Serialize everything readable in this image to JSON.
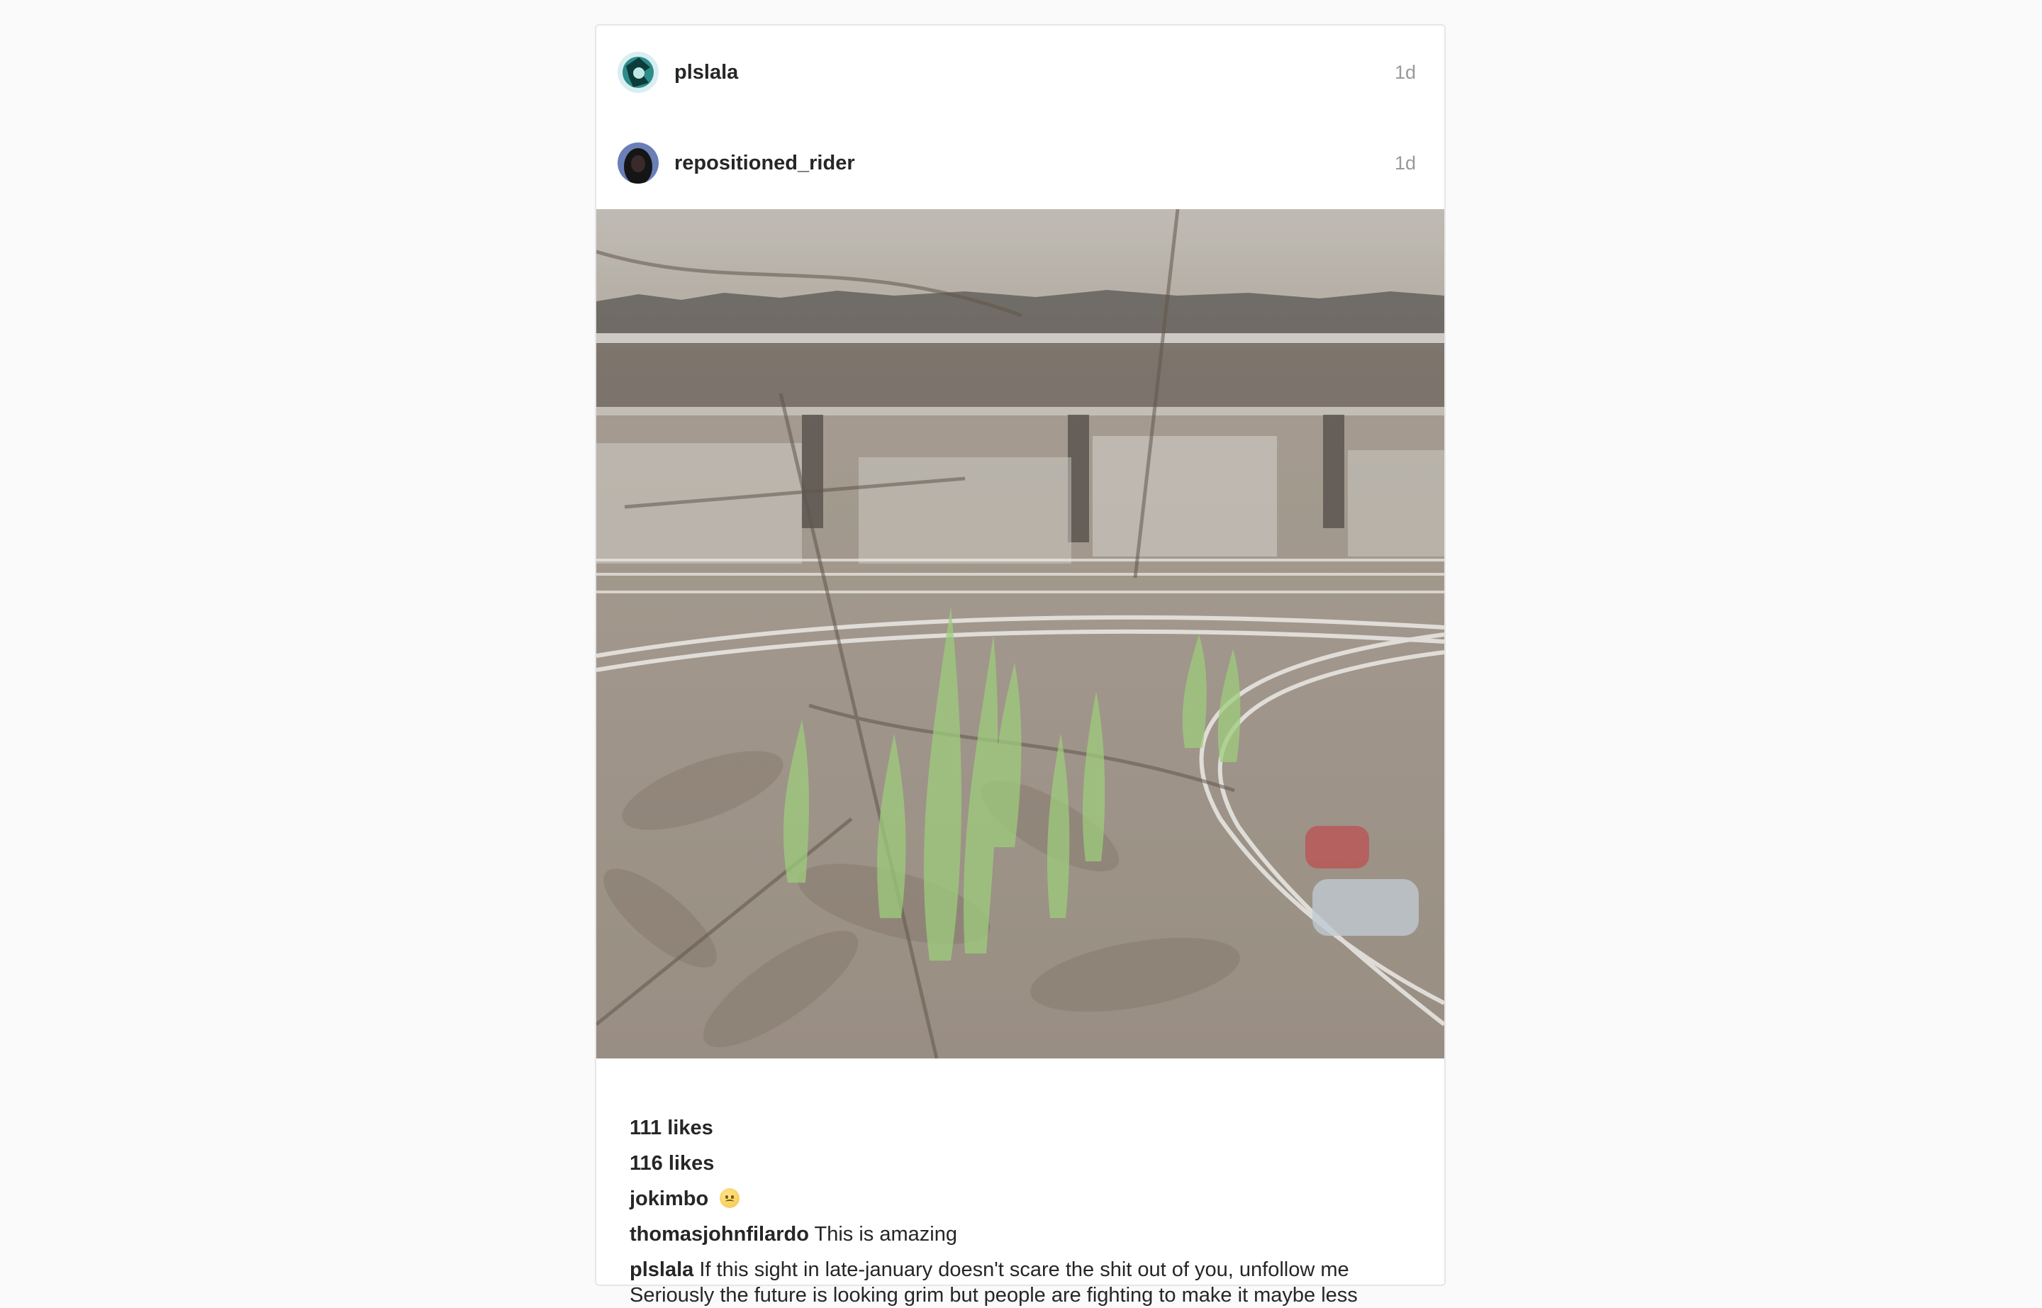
{
  "posts": [
    {
      "username": "plslala",
      "time": "1d",
      "avatar_icon": "avatar-teal-art-icon"
    },
    {
      "username": "repositioned_rider",
      "time": "1d",
      "avatar_icon": "avatar-dark-hair-portrait-icon"
    }
  ],
  "photo": {
    "icon": "overlaid-highway-and-sprouts-photo"
  },
  "likes": [
    "111 likes",
    "116 likes"
  ],
  "comments": [
    {
      "user": "jokimbo",
      "text": "",
      "emoji": "sad-face-emoji-icon"
    },
    {
      "user": "thomasjohnfilardo",
      "text": "This is amazing"
    }
  ],
  "caption": {
    "user": "plslala",
    "text": "If this sight in late-january doesn't scare the shit out of you, unfollow me Seriously the future is looking grim but people are fighting to make it maybe less"
  },
  "colors": {
    "background": "#fafafa",
    "card": "#ffffff",
    "border": "#e6e6e6",
    "muted_text": "#999999",
    "text": "#262626"
  }
}
